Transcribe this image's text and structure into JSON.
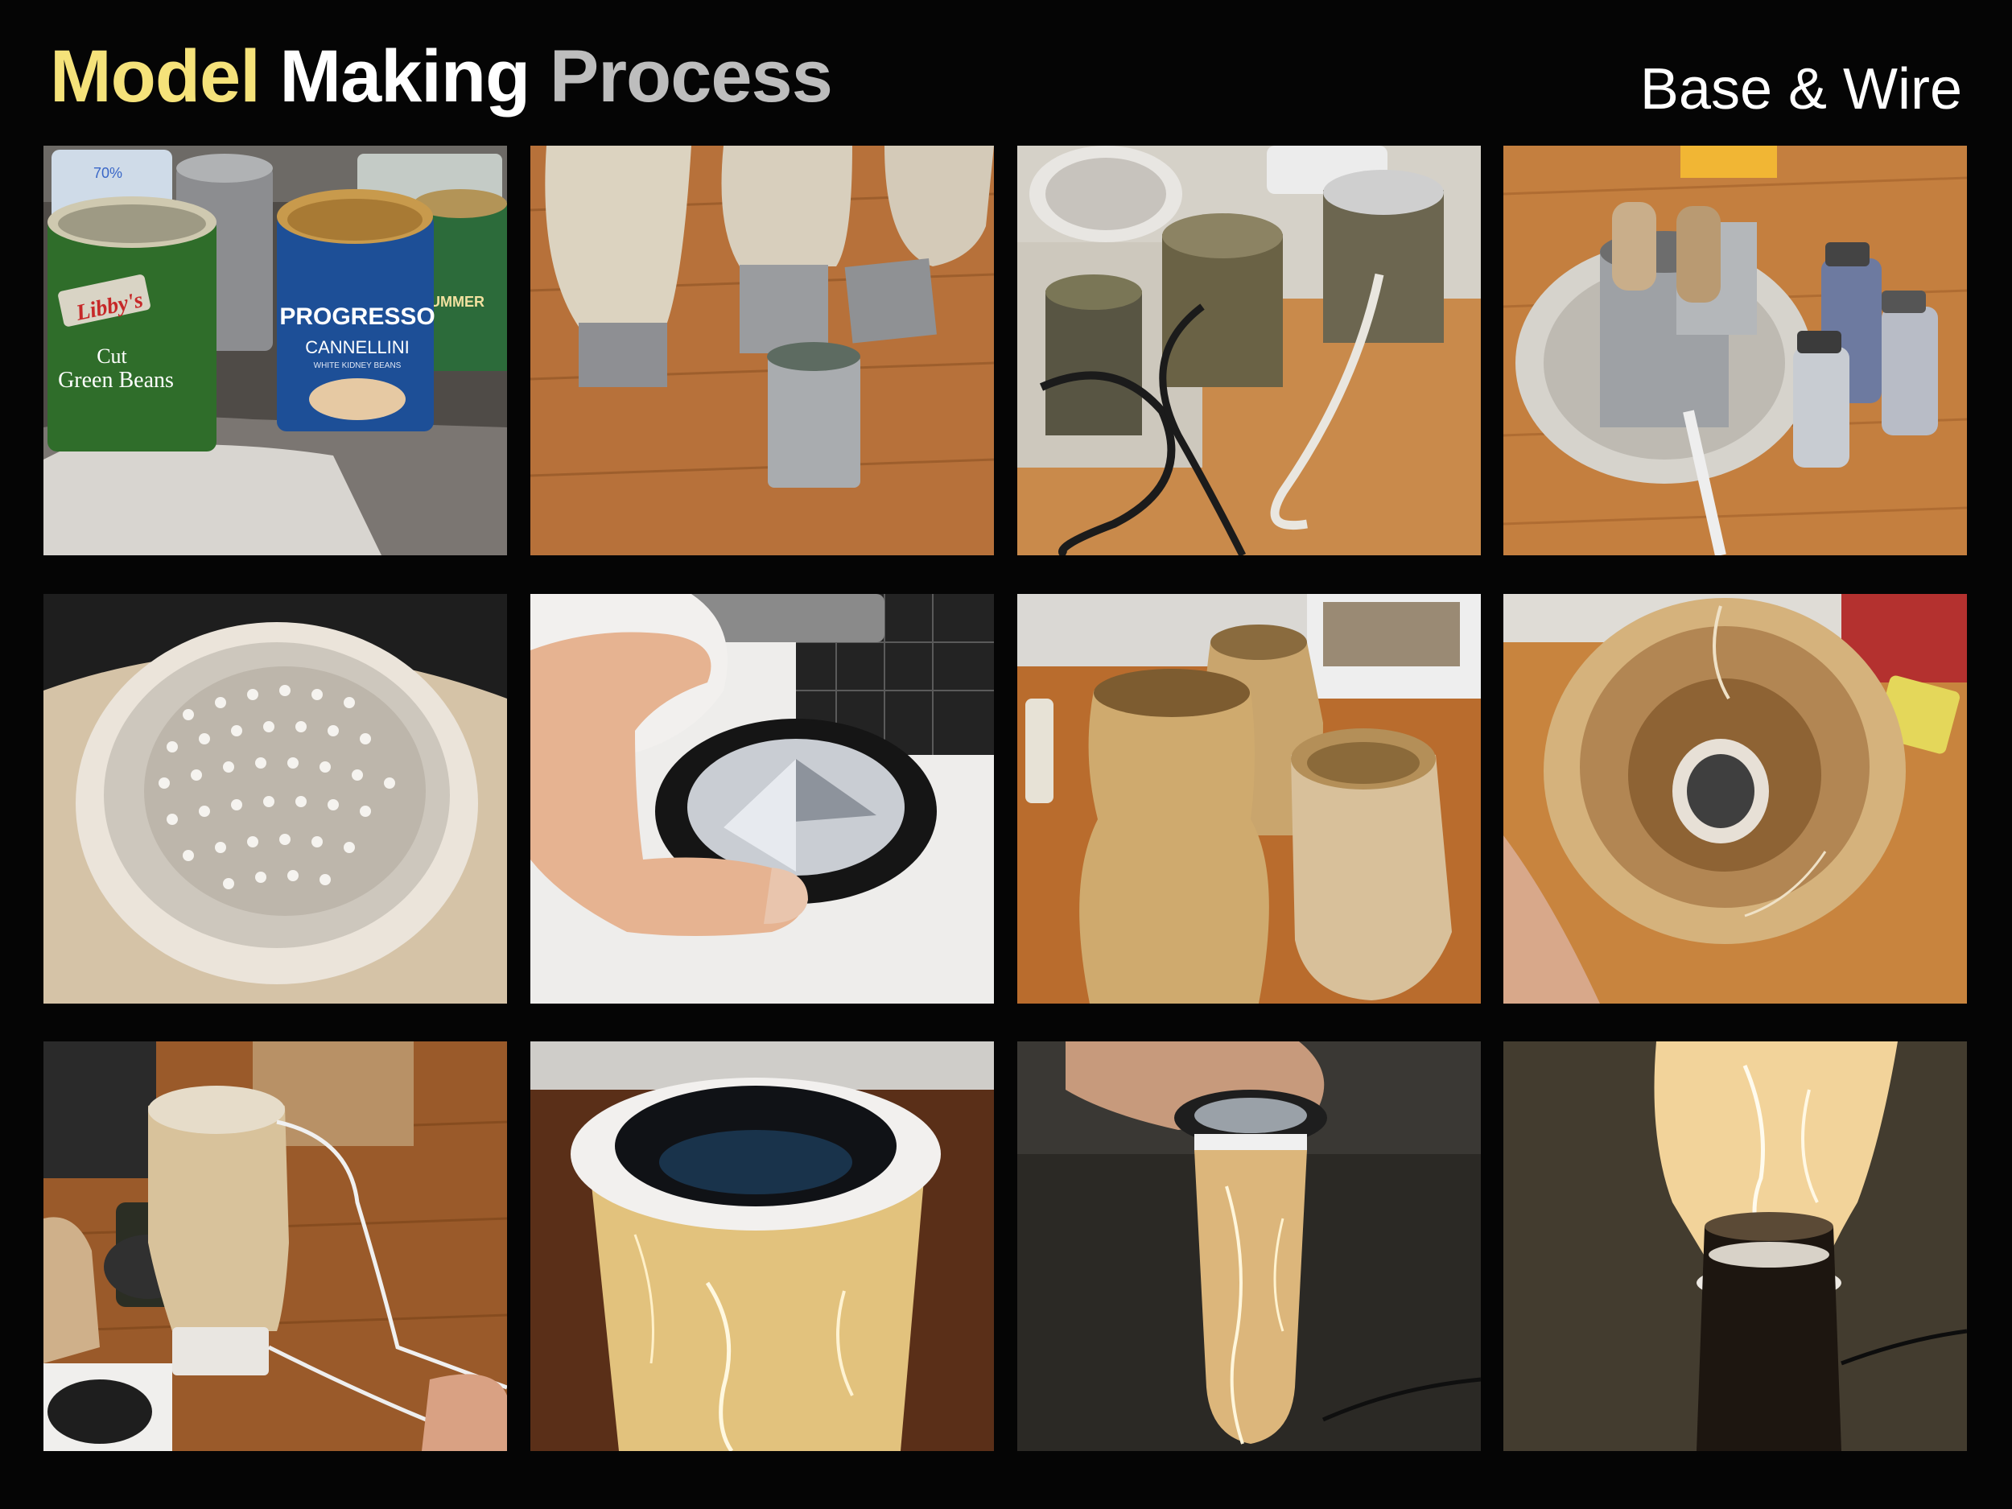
{
  "header": {
    "title_word_1": "Model",
    "title_word_2": "Making",
    "title_word_3": "Process",
    "subtitle": "Base & Wire"
  },
  "colors": {
    "background": "#050505",
    "title_accent": "#f5e27a",
    "title_white": "#ffffff",
    "title_gray": "#bdbdbd"
  },
  "photos": {
    "can_labels": {
      "libbys": "Libby's",
      "cut": "Cut",
      "green_beans": "Green Beans",
      "progresso": "PROGRESSO",
      "cannellini": "CANNELLINI",
      "white_kidney_beans": "WHITE KIDNEY BEANS",
      "summer": "SUMMER",
      "bottle_pct": "70%"
    }
  }
}
